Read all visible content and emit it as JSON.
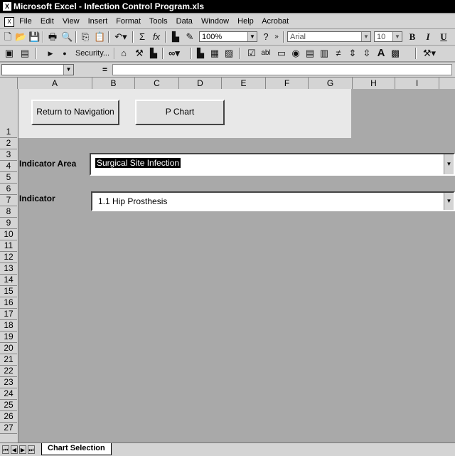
{
  "window": {
    "title": "Microsoft Excel - Infection Control Program.xls"
  },
  "menu": [
    "File",
    "Edit",
    "View",
    "Insert",
    "Format",
    "Tools",
    "Data",
    "Window",
    "Help",
    "Acrobat"
  ],
  "toolbar": {
    "zoom": "100%",
    "font": "Arial",
    "font_size": "10",
    "security_label": "Security..."
  },
  "columns": [
    "A",
    "B",
    "C",
    "D",
    "E",
    "F",
    "G",
    "H",
    "I"
  ],
  "rows": [
    "1",
    "2",
    "3",
    "4",
    "5",
    "6",
    "7",
    "8",
    "9",
    "10",
    "11",
    "12",
    "13",
    "14",
    "15",
    "16",
    "17",
    "18",
    "19",
    "20",
    "21",
    "22",
    "23",
    "24",
    "25",
    "26",
    "27"
  ],
  "sheet": {
    "return_button": "Return to Navigation",
    "pchart_button": "P Chart",
    "indicator_area_label": "Indicator Area",
    "indicator_area_value": "Surgical Site Infection",
    "indicator_label": "Indicator",
    "indicator_value": "1.1 Hip Prosthesis"
  },
  "tabs": {
    "active": "Chart Selection"
  }
}
